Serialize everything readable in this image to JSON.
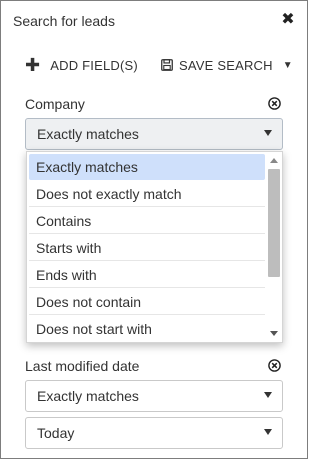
{
  "panel": {
    "title": "Search for leads",
    "close_icon": "close-icon"
  },
  "toolbar": {
    "add_label": "ADD FIELD(S)",
    "add_icon": "plus-icon",
    "save_label": "SAVE SEARCH",
    "save_icon": "floppy-disk-icon"
  },
  "company": {
    "label": "Company",
    "selected": "Exactly matches",
    "options": [
      "Exactly matches",
      "Does not exactly match",
      "Contains",
      "Starts with",
      "Ends with",
      "Does not contain",
      "Does not start with"
    ],
    "highlight_color": "#cfe0fb"
  },
  "last_modified": {
    "label": "Last modified date",
    "operator": "Exactly matches",
    "value": "Today"
  }
}
